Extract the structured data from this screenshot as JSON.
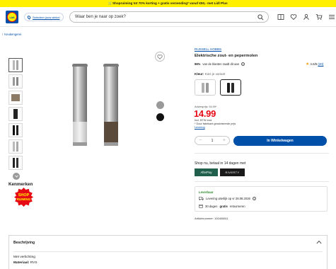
{
  "promo": {
    "text": "🛒Shopruiming tot 70% korting + gratis verzending* vanaf €50,- met Lidl Plus"
  },
  "header": {
    "logo_text": "Lidl",
    "store_label": "Selecteer jouw winkel",
    "search_placeholder": "Waar ben je naar op zoek?",
    "icons": [
      "search-icon",
      "catalog-icon",
      "heart-icon",
      "user-icon",
      "cart-icon",
      "menu-icon"
    ]
  },
  "breadcrumb": {
    "sep": "/",
    "item": "Keukengerei"
  },
  "product": {
    "brand": "RUSSELL HOBBS",
    "title": "Elektrische zout- en pepermolen",
    "recommend_pct": "96%",
    "recommend_text": "van de klanten raadt dit aan",
    "rating": "4.6/5",
    "rating_count": "(20)",
    "variant_label": "Kleur:",
    "variant_value": "Kies je variant",
    "old_price_label": "Adviesprijs: 54.99*",
    "price": "14.99",
    "price_note_1": "Incl. BTW excl.",
    "price_note_2": "* Door fabrikant geadviseerde prijs",
    "price_note_3": "Levering",
    "qty": "1",
    "cart_label": "In Winkelwagen",
    "shop_now_label": "Shop nu, betaal in 14 dagen met",
    "pay_1": "AfterPay",
    "pay_2": "RIVERTY",
    "delivery_status": "Leverbaar",
    "delivery_date": "Levering uiterlijk op vr 28.08.2026",
    "returns_prefix": "30 dagen",
    "returns_bold": "gratis",
    "returns_suffix": "retourneren",
    "article": "Artikelnummer: 100406811"
  },
  "features": {
    "heading": "Kenmerken",
    "badge_line1": "SHOP",
    "badge_line2": "RUIMING"
  },
  "description": {
    "title": "Beschrijving",
    "line1": "Met verlichting",
    "material_label": "Materiaal:",
    "material_value": "RVS"
  },
  "colors": {
    "brand_blue": "#0050aa",
    "promo_yellow": "#fff000",
    "price_red": "#e60a14",
    "afterpay_green": "#1f5f4b"
  }
}
